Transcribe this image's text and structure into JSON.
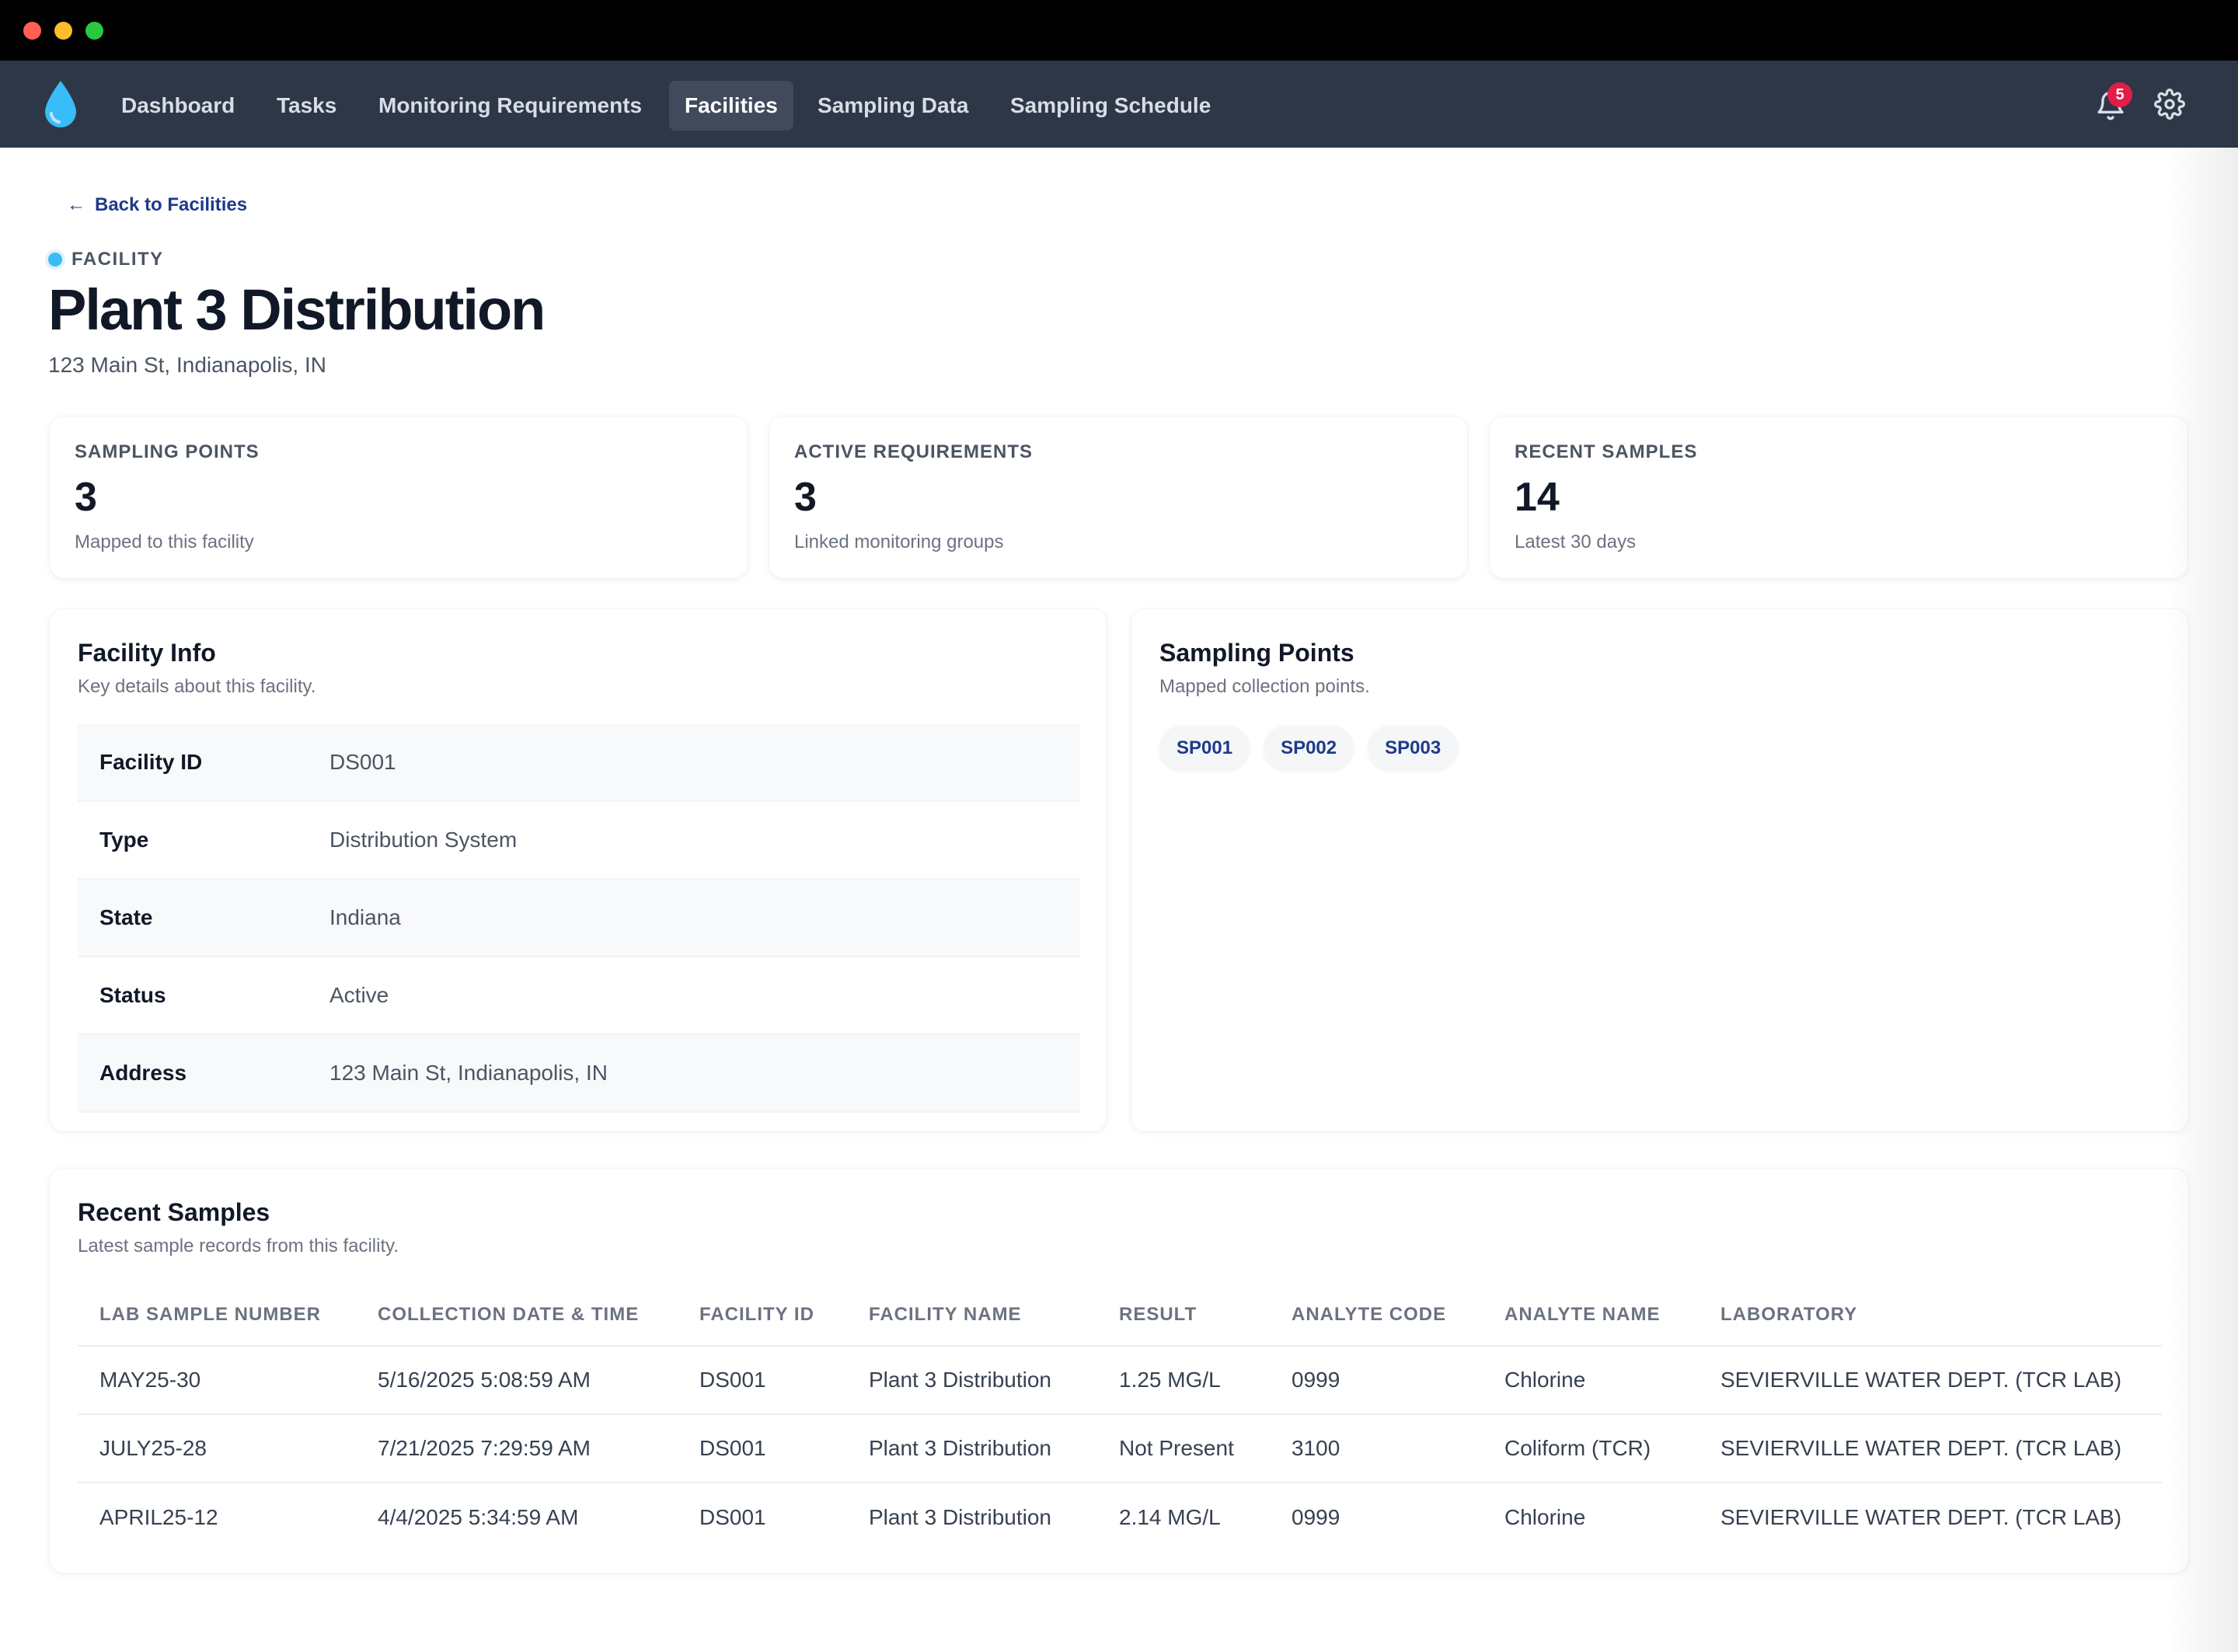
{
  "nav": {
    "items": [
      {
        "label": "Dashboard"
      },
      {
        "label": "Tasks"
      },
      {
        "label": "Monitoring Requirements"
      },
      {
        "label": "Facilities",
        "active": true
      },
      {
        "label": "Sampling Data"
      },
      {
        "label": "Sampling Schedule"
      }
    ],
    "notification_count": "5",
    "icons": [
      "water-drop-logo",
      "bell-icon",
      "gear-icon"
    ]
  },
  "back_link": "Back to Facilities",
  "eyebrow": "FACILITY",
  "title": "Plant 3 Distribution",
  "subtitle": "123 Main St, Indianapolis, IN",
  "stats": [
    {
      "label": "SAMPLING POINTS",
      "value": "3",
      "note": "Mapped to this facility"
    },
    {
      "label": "ACTIVE REQUIREMENTS",
      "value": "3",
      "note": "Linked monitoring groups"
    },
    {
      "label": "RECENT SAMPLES",
      "value": "14",
      "note": "Latest 30 days"
    }
  ],
  "facility_info": {
    "title": "Facility Info",
    "subtitle": "Key details about this facility.",
    "rows": [
      {
        "key": "Facility ID",
        "value": "DS001"
      },
      {
        "key": "Type",
        "value": "Distribution System"
      },
      {
        "key": "State",
        "value": "Indiana"
      },
      {
        "key": "Status",
        "value": "Active"
      },
      {
        "key": "Address",
        "value": "123 Main St, Indianapolis, IN"
      }
    ]
  },
  "sampling_points": {
    "title": "Sampling Points",
    "subtitle": "Mapped collection points.",
    "chips": [
      "SP001",
      "SP002",
      "SP003"
    ]
  },
  "recent_samples": {
    "title": "Recent Samples",
    "subtitle": "Latest sample records from this facility.",
    "columns": [
      "LAB SAMPLE NUMBER",
      "COLLECTION DATE & TIME",
      "FACILITY ID",
      "FACILITY NAME",
      "RESULT",
      "ANALYTE CODE",
      "ANALYTE NAME",
      "LABORATORY"
    ],
    "rows": [
      [
        "MAY25-30",
        "5/16/2025 5:08:59 AM",
        "DS001",
        "Plant 3 Distribution",
        "1.25 MG/L",
        "0999",
        "Chlorine",
        "SEVIERVILLE WATER DEPT. (TCR LAB)"
      ],
      [
        "JULY25-28",
        "7/21/2025 7:29:59 AM",
        "DS001",
        "Plant 3 Distribution",
        "Not Present",
        "3100",
        "Coliform (TCR)",
        "SEVIERVILLE WATER DEPT. (TCR LAB)"
      ],
      [
        "APRIL25-12",
        "4/4/2025 5:34:59 AM",
        "DS001",
        "Plant 3 Distribution",
        "2.14 MG/L",
        "0999",
        "Chlorine",
        "SEVIERVILLE WATER DEPT. (TCR LAB)"
      ]
    ]
  },
  "colors": {
    "navbar": "#2e3748",
    "accent": "#1e3a8a",
    "badge": "#e11d48",
    "logo": "#38bdf8"
  }
}
